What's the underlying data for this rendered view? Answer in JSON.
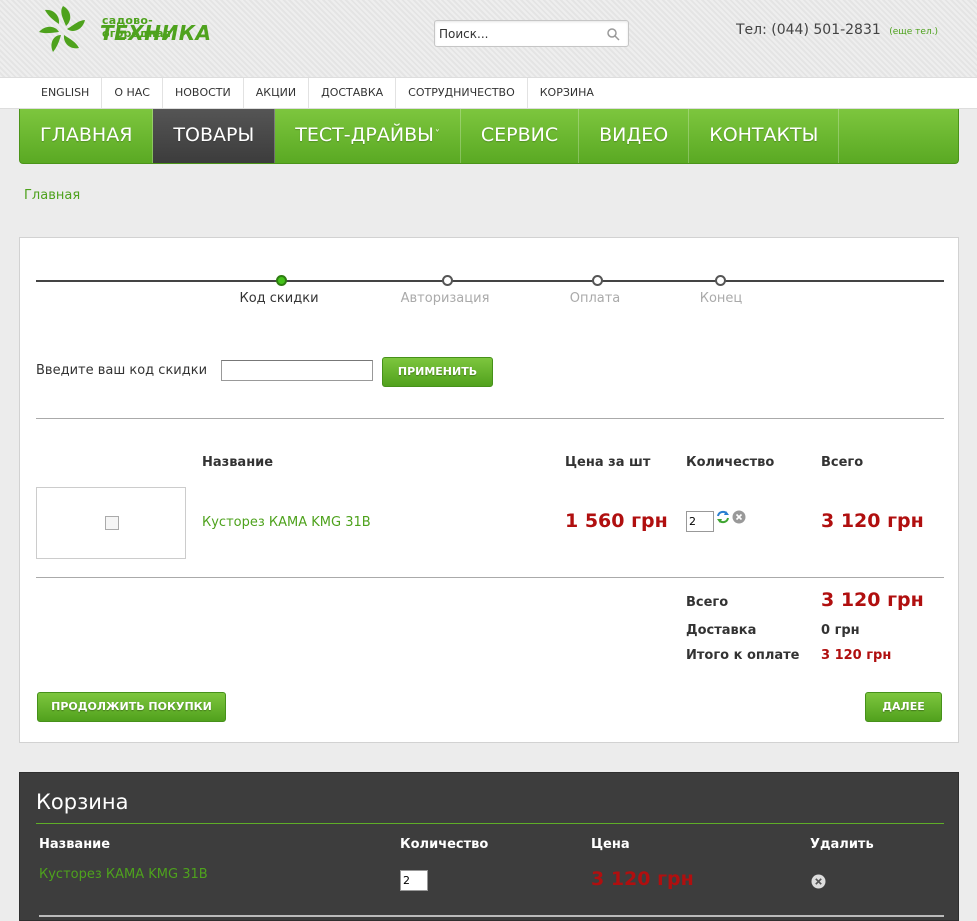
{
  "header": {
    "logo_small": "садово-огородная",
    "logo_big": "ТЕХНИКА",
    "search_placeholder": "Поиск...",
    "phone": "Тел: (044) 501-2831",
    "phone_more": "(еще тел.)"
  },
  "topnav": [
    "ENGLISH",
    "О НАС",
    "НОВОСТИ",
    "АКЦИИ",
    "ДОСТАВКА",
    "СОТРУДНИЧЕСТВО",
    "КОРЗИНА"
  ],
  "mainnav": {
    "items": [
      "ГЛАВНАЯ",
      "ТОВАРЫ",
      "ТЕСТ-ДРАЙВЫ",
      "СЕРВИС",
      "ВИДЕО",
      "КОНТАКТЫ"
    ],
    "active": "ТОВАРЫ"
  },
  "breadcrumb": "Главная",
  "checkout": {
    "steps": [
      "Код скидки",
      "Авторизация",
      "Оплата",
      "Конец"
    ],
    "active_step": "Код скидки",
    "discount_label": "Введите ваш код скидки",
    "discount_value": "",
    "apply_button": "ПРИМЕНИТЬ",
    "columns": {
      "name": "Название",
      "unit_price": "Цена за шт",
      "quantity": "Количество",
      "total": "Всего"
    },
    "item": {
      "name": "Кусторез КАМА KMG 31B",
      "unit_price": "1 560 грн",
      "quantity": "2",
      "total": "3 120 грн"
    },
    "summary": {
      "total_label": "Всего",
      "total_value": "3 120 грн",
      "delivery_label": "Доставка",
      "delivery_value": "0 грн",
      "grand_label": "Итого к оплате",
      "grand_value": "3 120 грн"
    },
    "continue_button": "ПРОДОЛЖИТЬ ПОКУПКИ",
    "next_button": "ДАЛЕЕ"
  },
  "cart": {
    "title": "Корзина",
    "columns": {
      "name": "Название",
      "quantity": "Количество",
      "price": "Цена",
      "remove": "Удалить"
    },
    "item": {
      "name": "Кусторез КАМА KMG 31B",
      "quantity": "2",
      "price": "3 120 грн"
    }
  },
  "colors": {
    "brand_green": "#5aa923",
    "price_red": "#b00f0f",
    "cart_bg": "#3d3d3d"
  }
}
